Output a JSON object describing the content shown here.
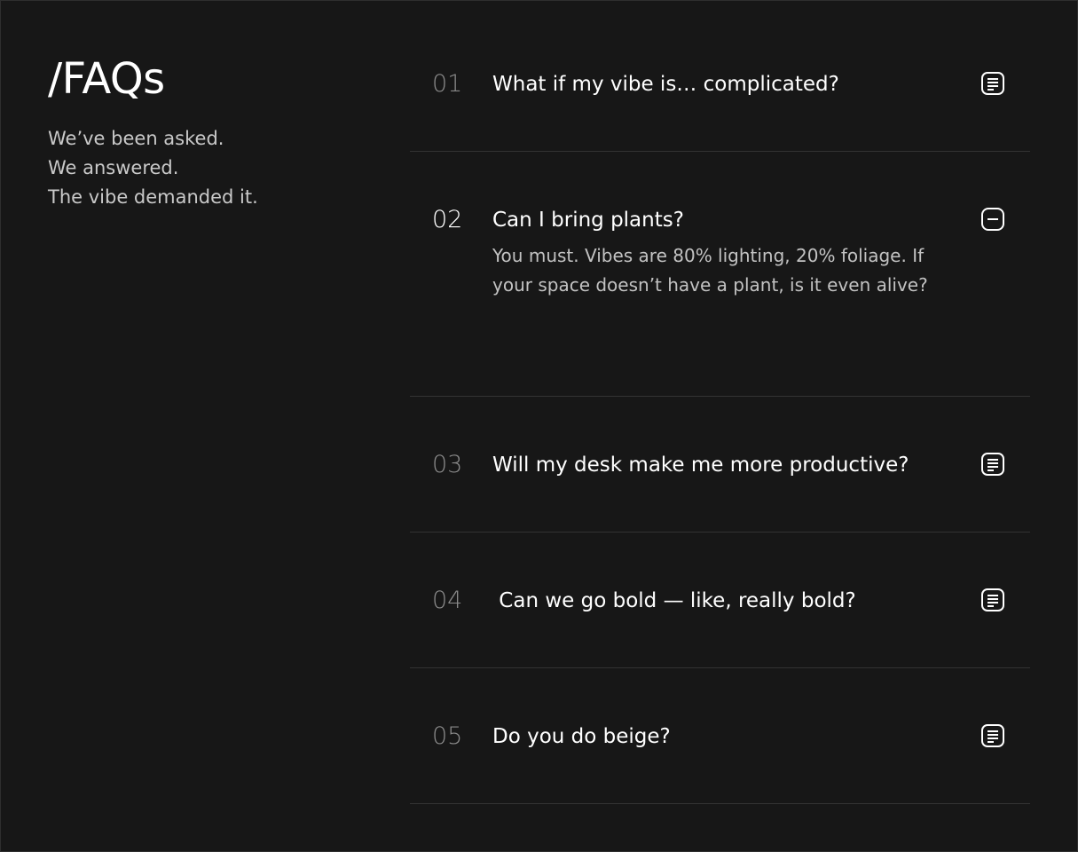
{
  "intro": {
    "title": "/FAQs",
    "tagline": [
      "We’ve been asked.",
      "We answered.",
      "The vibe demanded it."
    ]
  },
  "faqs": [
    {
      "number": "01",
      "question": "What if my vibe is… complicated?",
      "expanded": false,
      "icon": "document-lines-icon"
    },
    {
      "number": "02",
      "question": "Can I bring plants?",
      "answer": "You must. Vibes are 80% lighting, 20% foliage. If your space doesn’t have a plant, is it even alive?",
      "expanded": true,
      "icon": "collapse-minus-icon"
    },
    {
      "number": "03",
      "question": "Will my desk make me more productive?",
      "expanded": false,
      "icon": "document-lines-icon"
    },
    {
      "number": "04",
      "question": " Can we go bold — like, really bold?",
      "expanded": false,
      "icon": "document-lines-icon"
    },
    {
      "number": "05",
      "question": "Do you do beige?",
      "expanded": false,
      "icon": "document-lines-icon"
    }
  ],
  "colors": {
    "background": "#171717",
    "divider": "#333333",
    "muted_number": "#8a8a8a",
    "body_text": "#c2c2c2"
  }
}
